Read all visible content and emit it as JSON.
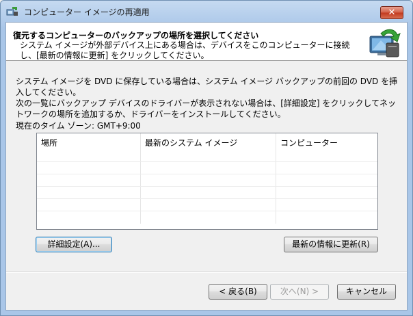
{
  "window": {
    "title": "コンピューター イメージの再適用",
    "close_label": "✕"
  },
  "header": {
    "title": "復元するコンピューターのバックアップの場所を選択してください",
    "description": "システム イメージが外部デバイス上にある場合は、デバイスをこのコンピューターに接続し、[最新の情報に更新] をクリックしてください。"
  },
  "main": {
    "info_line1": "システム イメージを DVD に保存している場合は、システム イメージ バックアップの前回の DVD を挿入してください。",
    "info_line2": "次の一覧にバックアップ デバイスのドライバーが表示されない場合は、[詳細設定] をクリックしてネットワークの場所を追加するか、ドライバーをインストールしてください。",
    "timezone": "現在のタイム ゾーン: GMT+9:00",
    "columns": [
      "場所",
      "最新のシステム イメージ",
      "コンピューター"
    ],
    "advanced_button": "詳細設定(A)...",
    "refresh_button": "最新の情報に更新(R)"
  },
  "footer": {
    "back_button": "< 戻る(B)",
    "next_button": "次へ(N) >",
    "cancel_button": "キャンセル"
  },
  "colors": {
    "title_bar": "#c6daf1",
    "close_button": "#c2391f",
    "focus_border": "#3c7fb1"
  }
}
